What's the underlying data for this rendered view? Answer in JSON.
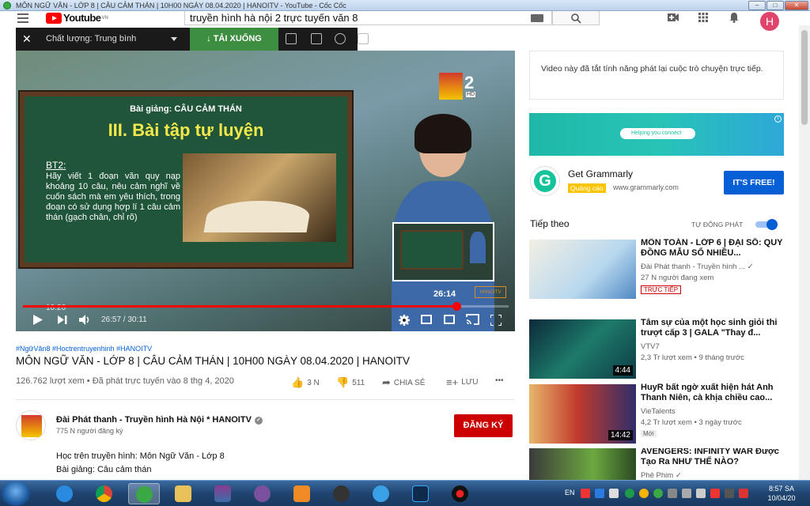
{
  "window": {
    "title": "MÔN NGỮ VĂN - LỚP 8 | CÂU CẢM THÁN | 10H00 NGÀY 08.04.2020 | HANOITV - YouTube - Cốc Cốc",
    "min": "–",
    "max": "□",
    "close": "✕"
  },
  "header": {
    "logo": "Youtube",
    "logo_region": "VN",
    "search_value": "truyền hình hà nội 2 trực tuyến văn 8",
    "avatar_letter": "H"
  },
  "video_toolbar": {
    "close": "✕",
    "quality": "Chất lượng: Trung bình",
    "download": "↓ TẢI XUỐNG"
  },
  "video": {
    "channel_number": "2",
    "channel_hd": "HD",
    "board_lecture": "Bài giảng: CÂU CẢM THÁN",
    "board_section": "III. Bài tập tự luyện",
    "board_exercise": "BT2:",
    "board_text": "Hãy viết 1 đoạn văn quy nạp khoảng 10 câu, nêu cảm nghĩ về cuốn sách mà em yêu thích, trong đoạn có sử dụng hợp lí 1 câu cảm thán (gạch chân, chỉ rõ)",
    "preview_time": "26:14",
    "watermark": "HANOITV",
    "overlay_time": "10:26",
    "current_time": "26:57 / 30:11",
    "progress": 0.893
  },
  "info": {
    "tags": "#NgữVăn8 #Hoctrentruyenhinh #HANOITV",
    "title": "MÔN NGỮ VĂN - LỚP 8 | CÂU CẢM THÁN | 10H00 NGÀY 08.04.2020 | HANOITV",
    "views": "126.762 lượt xem • Đã phát trực tuyến vào 8 thg 4, 2020",
    "likes": "3 N",
    "dislikes": "511",
    "share": "CHIA SẺ",
    "save": "LƯU",
    "more": "•••"
  },
  "channel": {
    "name": "Đài Phát thanh - Truyền hình Hà Nội * HANOITV",
    "verified": "✓",
    "subs": "775 N người đăng ký",
    "subscribe": "ĐĂNG KÝ",
    "desc_lines": [
      "Học trên truyền hình: Môn Ngữ Văn - Lớp 8",
      "Bài giảng: Câu cảm thán"
    ]
  },
  "sidebar": {
    "chat_notice": "Video này đã tắt tính năng phát lại cuộc trò chuyện trực tiếp.",
    "ad_pill": "Helping you connect",
    "ad_info": "i",
    "ad_title": "Get Grammarly",
    "ad_badge": "Quảng cáo",
    "ad_url": "www.grammarly.com",
    "ad_button": "IT'S FREE!",
    "ad_icon_letter": "G",
    "up_next": "Tiếp theo",
    "autoplay": "TỰ ĐỘNG PHÁT",
    "autoplay_on": true,
    "recs": [
      {
        "title": "MÔN TOÁN - LỚP 6 | ĐẠI SỐ: QUY ĐỒNG MẪU SỐ NHIỀU...",
        "channel": "Đài Phát thanh - Truyền hình ... ✓",
        "meta": "27 N người đang xem",
        "badge": "TRỰC TIẾP",
        "duration": ""
      },
      {
        "title": "Tâm sự của một học sinh giỏi thi trượt cấp 3 | GALA \"Thay đ...",
        "channel": "VTV7",
        "meta": "2,3 Tr lượt xem • 9 tháng trước",
        "badge": "",
        "duration": "4:44"
      },
      {
        "title": "HuyR bất ngờ xuất hiện hát Anh Thanh Niên, cà khịa chiều cao...",
        "channel": "VieTalents",
        "meta": "4,2 Tr lượt xem • 3 ngày trước",
        "badge": "Mới",
        "duration": "14:42"
      },
      {
        "title": "AVENGERS: INFINITY WAR Được Tạo Ra NHƯ THẾ NÀO?",
        "channel": "Phê Phim ✓",
        "meta": "",
        "badge": "",
        "duration": ""
      }
    ]
  },
  "taskbar": {
    "lang": "EN",
    "time": "8:57 SA",
    "date": "10/04/20"
  },
  "colors": {
    "accent": "#ff0000",
    "subscribe": "#cc0000",
    "link": "#065fd4",
    "download": "#3e8e41"
  }
}
